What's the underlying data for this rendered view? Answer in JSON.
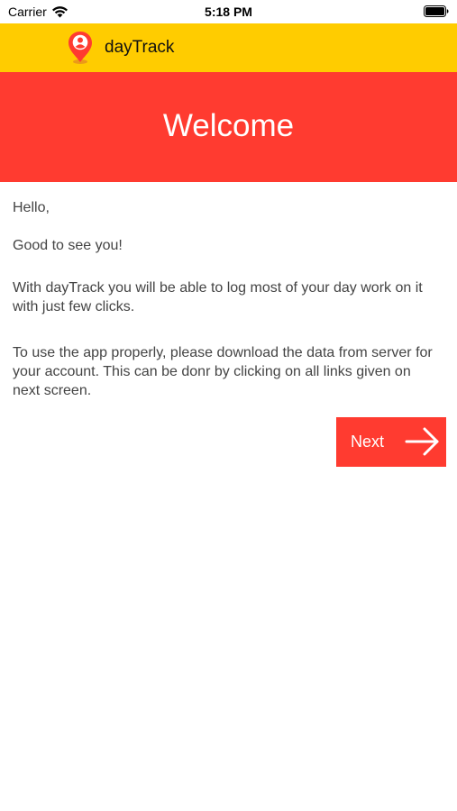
{
  "status_bar": {
    "carrier": "Carrier",
    "time": "5:18 PM",
    "wifi_icon": "wifi-icon",
    "battery_icon": "battery-icon"
  },
  "app_bar": {
    "title": "dayTrack",
    "logo_icon": "location-pin-user-icon",
    "background_color": "#ffcc00"
  },
  "banner": {
    "title": "Welcome",
    "background_color": "#ff3b30"
  },
  "body": {
    "greeting": "Hello,",
    "subtitle": "Good to see you!",
    "intro": "With dayTrack you will be able to log most of your day work on it with just few clicks.",
    "instructions": "To use the app properly, please download the data from server for your account. This can be donr by clicking on all links given on next screen."
  },
  "next_button": {
    "label": "Next",
    "icon": "arrow-right-icon",
    "background_color": "#ff3b30"
  }
}
